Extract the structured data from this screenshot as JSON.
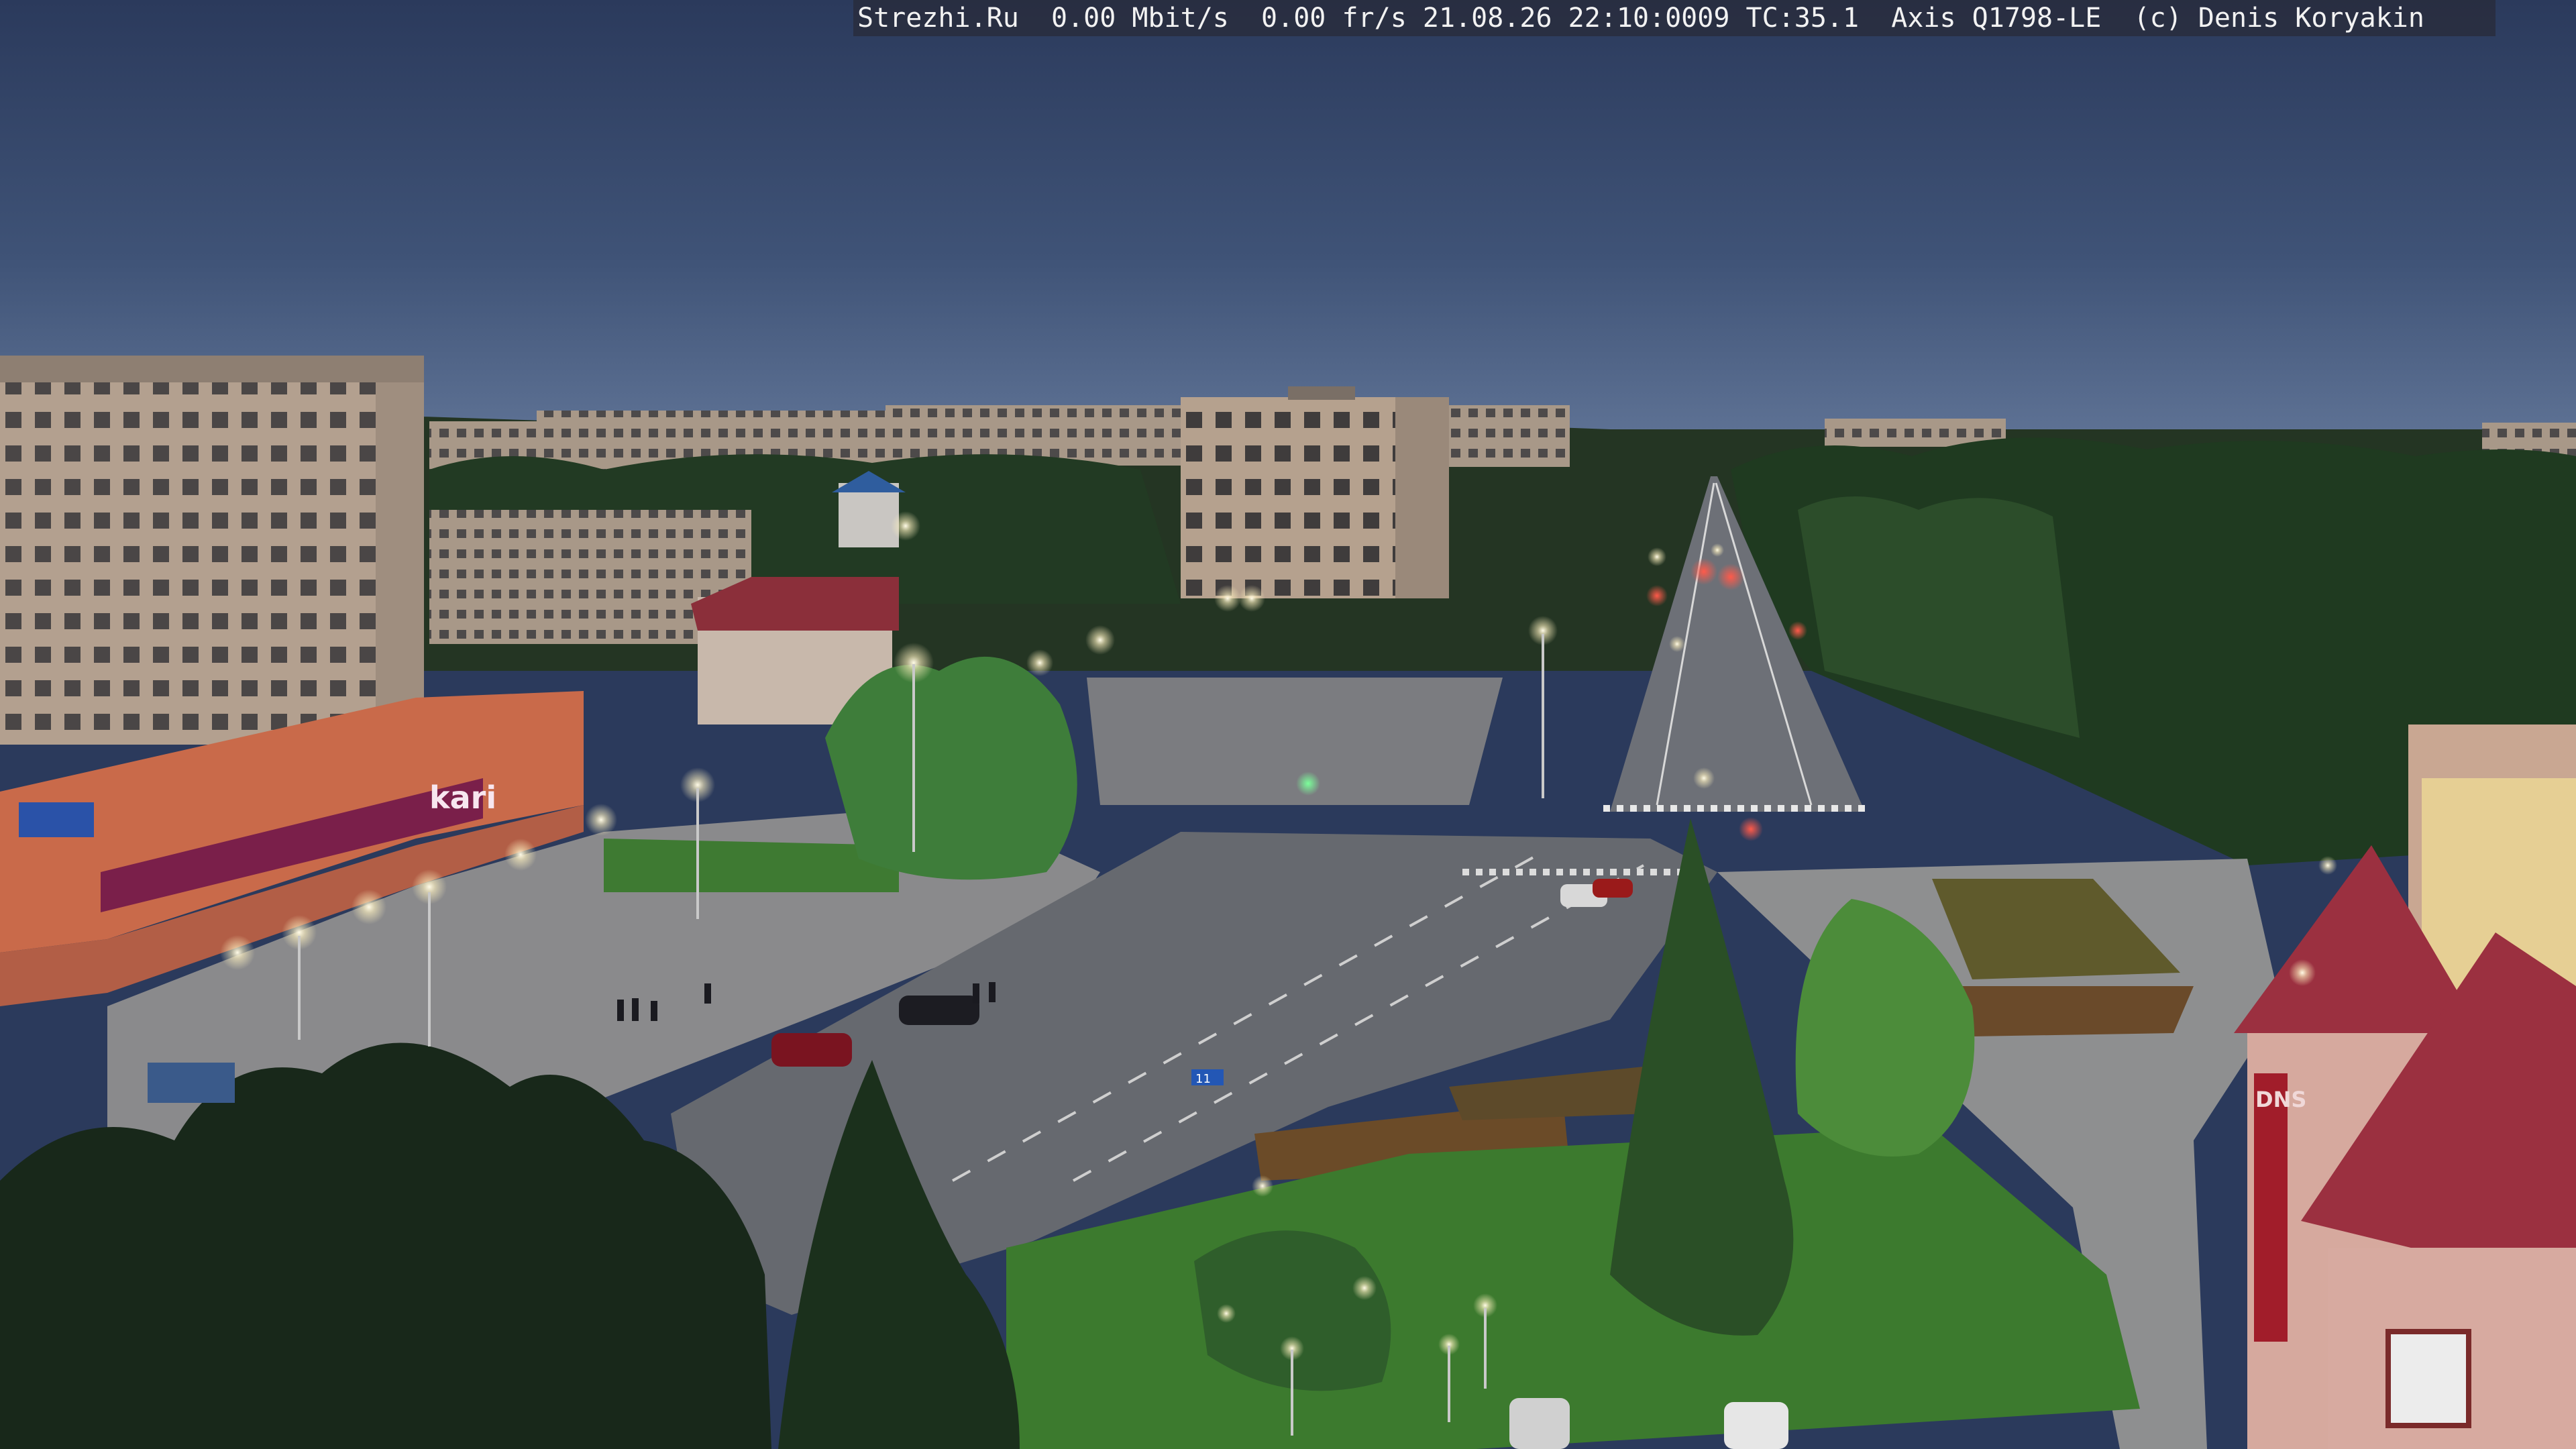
{
  "overlay": {
    "text": "Strezhi.Ru  0.00 Mbit/s  0.00 fr/s 21.08.26 22:10:0009 TC:35.1  Axis Q1798-LE  (c) Denis Koryakin"
  },
  "signs": {
    "store": "kari",
    "store_right": "DNS",
    "road_sign": "11"
  },
  "palette": {
    "sky_top": "#2b3a5c",
    "sky_bottom": "#5a6f8e",
    "forest": "#1f3320",
    "grass": "#3f7a2f",
    "road": "#6a6e76",
    "plaza": "#8a8a8c",
    "panel_building": "#b9a493",
    "red_roof": "#8b2f3a",
    "lamp": "#fff6d8"
  }
}
